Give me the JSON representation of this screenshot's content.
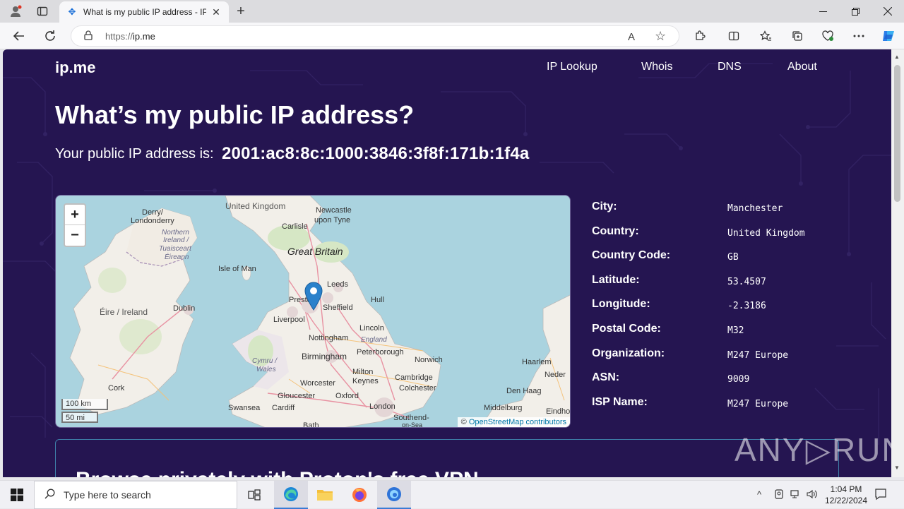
{
  "browser": {
    "tab_title": "What is my public IP address - IP",
    "url_prefix": "https://",
    "url_host": "ip.me",
    "read_aloud_label": "A"
  },
  "site": {
    "logo": "ip.me",
    "nav": [
      "IP Lookup",
      "Whois",
      "DNS",
      "About"
    ],
    "heading": "What’s my public IP address?",
    "ip_label": "Your public IP address is:",
    "ip_value": "2001:ac8:8c:1000:3846:3f8f:171b:1f4a"
  },
  "map": {
    "zoom_in": "+",
    "zoom_out": "−",
    "scale_km": "100 km",
    "scale_mi": "50 mi",
    "attribution_symbol": "©",
    "attribution_link": "OpenStreetMap contributors",
    "labels": {
      "united_kingdom": "United Kingdom",
      "derry": "Derry/",
      "londonderry": "Londonderry",
      "newcastle": "Newcastle",
      "upon_tyne": "upon Tyne",
      "carlisle": "Carlisle",
      "northern": "Northern",
      "ireland": "Ireland /",
      "tuaisceart": "Tuaisceart",
      "eireann": "Éireann",
      "great_britain": "Great Britain",
      "isle_of_man": "Isle of Man",
      "leeds": "Leeds",
      "preston": "Presto",
      "sheffield": "Sheffield",
      "hull": "Hull",
      "eire": "Éire / Ireland",
      "dublin": "Dublin",
      "liverpool": "Liverpool",
      "lincoln": "Lincoln",
      "nottingham": "Nottingham",
      "england": "England",
      "peterborough": "Peterborough",
      "norwich": "Norwich",
      "haarlem": "Haarlem",
      "neder": "Neder",
      "birmingham": "Birmingham",
      "cymru": "Cymru /",
      "wales": "Wales",
      "milton": "Milton",
      "keynes": "Keynes",
      "cambridge": "Cambridge",
      "colchester": "Colchester",
      "cork": "Cork",
      "worcester": "Worcester",
      "den_haag": "Den Haag",
      "gloucester": "Gloucester",
      "oxford": "Oxford",
      "swansea": "Swansea",
      "cardiff": "Cardiff",
      "london": "London",
      "middelburg": "Middelburg",
      "southend": "Southend-",
      "on_sea": "on-Sea",
      "eindho": "Eindho",
      "bath": "Bath"
    }
  },
  "info": [
    {
      "key": "City:",
      "value": "Manchester"
    },
    {
      "key": "Country:",
      "value": "United Kingdom"
    },
    {
      "key": "Country Code:",
      "value": "GB"
    },
    {
      "key": "Latitude:",
      "value": "53.4507"
    },
    {
      "key": "Longitude:",
      "value": "-2.3186"
    },
    {
      "key": "Postal Code:",
      "value": "M32"
    },
    {
      "key": "Organization:",
      "value": "M247 Europe"
    },
    {
      "key": "ASN:",
      "value": "9009"
    },
    {
      "key": "ISP Name:",
      "value": "M247 Europe"
    }
  ],
  "promo": {
    "text": "Browse privately with Proton's free VPN"
  },
  "watermark": "ANY▷RUN",
  "taskbar": {
    "search_placeholder": "Type here to search",
    "time": "1:04 PM",
    "date": "12/22/2024"
  }
}
